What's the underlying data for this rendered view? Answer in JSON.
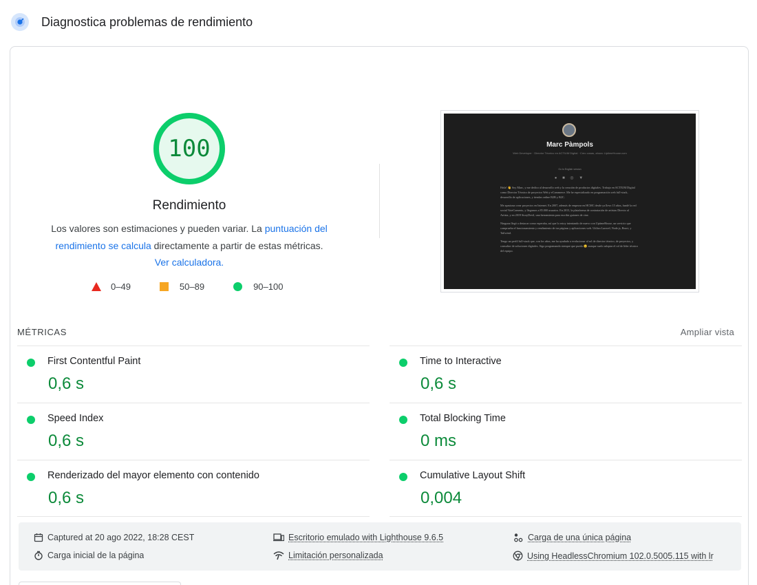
{
  "header": {
    "title": "Diagnostica problemas de rendimiento",
    "icon": "lighthouse-speed-icon"
  },
  "score": {
    "value": "100",
    "fraction": 1.0,
    "color": "#0cce6b",
    "text_color": "#0c8a3a",
    "title": "Rendimiento",
    "desc_prefix": "Los valores son estimaciones y pueden variar. La ",
    "desc_link1": "puntuación del rendimiento se calcula",
    "desc_middle": " directamente a partir de estas métricas. ",
    "desc_link2": "Ver calculadora."
  },
  "legend": [
    {
      "range": "0–49",
      "shape": "triangle",
      "color": "#e8291f"
    },
    {
      "range": "50–89",
      "shape": "square",
      "color": "#f6a623"
    },
    {
      "range": "90–100",
      "shape": "circle",
      "color": "#0cce6b"
    }
  ],
  "screenshot": {
    "name": "Marc Pàmpols",
    "subtitle": "Web Developer · Director Técnico en ACTIUM Digital · Creo cosas, ahora: UptimeHouse.com",
    "language": "Go to English version",
    "paragraphs": [
      "Hola! 👋 Soy Marc, y me dedico al desarrollo web y la creación de productos digitales. Trabajo en ACTIUM Digital como Director Técnico de proyectos Web y eCommerce. Me he especializado en programación web full-stack, desarrollo de aplicaciones, y tiendas online B2B y B2C.",
      "Me apasiona crear proyectos en Internet. En 2007, además de empezar en HCMC desde ya llevo 15 años, fundé la red social VoteComents, y llegamos a 85.000 usuarios. En 2015, la plataforma de contratación de artistas Directo al Artista, y en 2019 StoryDevil, una herramienta para escribir guiones de cine.",
      "Ninguna llegó a destacar como esperaba, así que lo estoy intentando de nuevo con UptimeHouse, un servicio que comprueba el funcionamiento y rendimiento de tus páginas y aplicaciones web. Utilizo Laravel, Node.js, React, y Tailwind.",
      "Tengo un perfil full-stack que, con los años, me ha ayudado a evolucionar al rol de director técnico, de proyectos, y consultor de soluciones digitales. Sigo programando siempre que puedo 😊 aunque suelo adoptar el rol de líder técnico del equipo."
    ]
  },
  "metrics": {
    "title": "MÉTRICAS",
    "expand": "Ampliar vista",
    "items": [
      {
        "label": "First Contentful Paint",
        "value": "0,6 s",
        "status": "good"
      },
      {
        "label": "Time to Interactive",
        "value": "0,6 s",
        "status": "good"
      },
      {
        "label": "Speed Index",
        "value": "0,6 s",
        "status": "good"
      },
      {
        "label": "Total Blocking Time",
        "value": "0 ms",
        "status": "good"
      },
      {
        "label": "Renderizado del mayor elemento con contenido",
        "value": "0,6 s",
        "status": "good"
      },
      {
        "label": "Cumulative Layout Shift",
        "value": "0,004",
        "status": "good"
      }
    ]
  },
  "footer": {
    "captured": "Captured at 20 ago 2022, 18:28 CEST",
    "initial_load": "Carga inicial de la página",
    "device": "Escritorio emulado with Lighthouse 9.6.5",
    "throttling": "Limitación personalizada",
    "single_page": "Carga de una única página",
    "browser": "Using HeadlessChromium 102.0.5005.115 with lr"
  },
  "colors": {
    "good": "#0cce6b",
    "good_text": "#0c8a3a",
    "link": "#1a73e8"
  }
}
